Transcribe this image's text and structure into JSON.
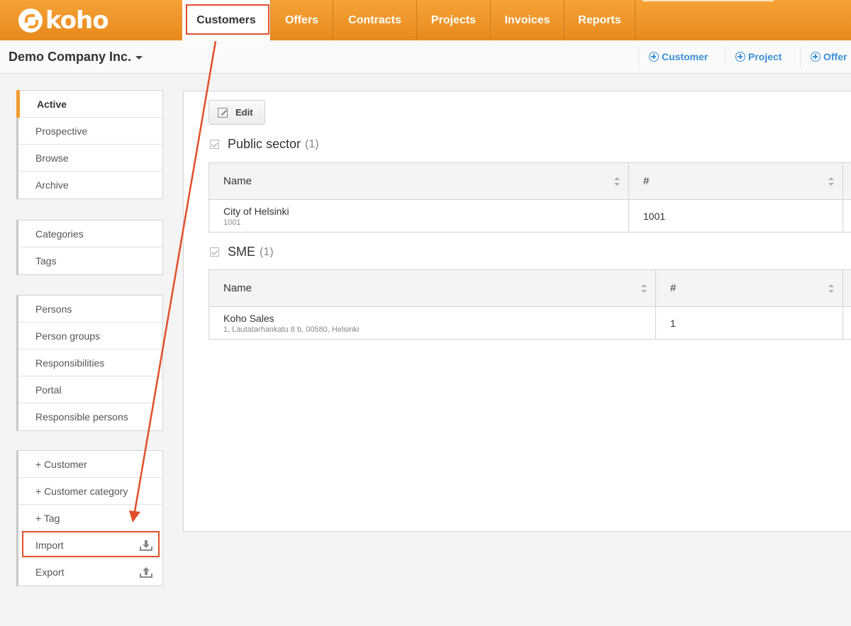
{
  "brand": {
    "name": "koho"
  },
  "nav": {
    "tabs": [
      "Customers",
      "Offers",
      "Contracts",
      "Projects",
      "Invoices",
      "Reports"
    ],
    "active": "Customers"
  },
  "header": {
    "company": "Demo Company Inc.",
    "quick_add": [
      "Customer",
      "Project",
      "Offer"
    ]
  },
  "sidebar": {
    "groups": [
      [
        "Active",
        "Prospective",
        "Browse",
        "Archive"
      ],
      [
        "Categories",
        "Tags"
      ],
      [
        "Persons",
        "Person groups",
        "Responsibilities",
        "Portal",
        "Responsible persons"
      ],
      [
        "+ Customer",
        "+ Customer category",
        "+ Tag",
        "Import",
        "Export"
      ]
    ],
    "active": "Active"
  },
  "main": {
    "edit_label": "Edit",
    "groups": [
      {
        "title": "Public sector",
        "count": "(1)",
        "columns": [
          "Name",
          "#"
        ],
        "rows": [
          {
            "name": "City of Helsinki",
            "sub": "1001",
            "number": "1001"
          }
        ]
      },
      {
        "title": "SME",
        "count": "(1)",
        "columns": [
          "Name",
          "#"
        ],
        "rows": [
          {
            "name": "Koho Sales",
            "sub": "1, Lautatarhankatu 8 b, 00580, Helsinki",
            "number": "1"
          }
        ]
      }
    ]
  },
  "annotations": {
    "color": "#e04f2b",
    "highlighted": [
      "Customers",
      "Import"
    ]
  }
}
